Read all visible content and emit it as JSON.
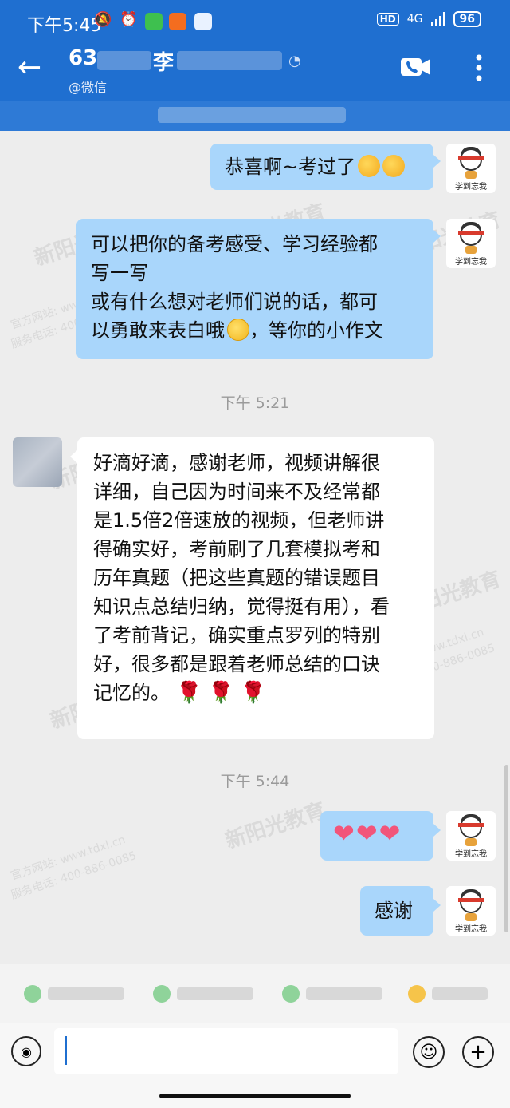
{
  "status_bar": {
    "time": "下午5:45",
    "network": "4G",
    "battery": "96",
    "hd_label": "HD",
    "icons": [
      "mute-bell-icon",
      "alarm-icon",
      "wechat-icon",
      "mi-app-icon",
      "app-icon"
    ]
  },
  "header": {
    "contact_prefix": "63",
    "contact_surname": "李",
    "source": "@微信",
    "back_icon": "back-arrow-icon",
    "call_icon": "video-call-icon",
    "more_icon": "more-vertical-icon"
  },
  "messages": [
    {
      "sender": "me",
      "avatar_text": "学到忘我",
      "text": "恭喜啊~考过了",
      "emoji": [
        "hugging-face",
        "hugging-face"
      ]
    },
    {
      "sender": "me",
      "avatar_text": "学到忘我",
      "lines": [
        "可以把你的备考感受、学习经验都",
        "写一写",
        "或有什么想对老师们说的话，都可",
        "以勇敢来表白哦"
      ],
      "line4_suffix": "，等你的小作文",
      "emoji": [
        "grinning-face"
      ]
    },
    {
      "type": "time",
      "text": "下午 5:21"
    },
    {
      "sender": "other",
      "lines": [
        "好滴好滴，感谢老师，视频讲解很",
        "详细，自己因为时间来不及经常都",
        "是1.5倍2倍速放的视频，但老师讲",
        "得确实好，考前刷了几套模拟考和",
        "历年真题（把这些真题的错误题目",
        "知识点总结归纳，觉得挺有用），看",
        "了考前背记，确实重点罗列的特别",
        "好，很多都是跟着老师总结的口诀",
        "记忆的。"
      ],
      "emoji": [
        "rose",
        "rose",
        "rose"
      ]
    },
    {
      "type": "time",
      "text": "下午 5:44"
    },
    {
      "sender": "me",
      "avatar_text": "学到忘我",
      "hearts": [
        "❤",
        "❤",
        "❤"
      ]
    },
    {
      "sender": "me",
      "avatar_text": "学到忘我",
      "text": "感谢"
    }
  ],
  "watermark": {
    "logo": "新阳光教育",
    "url": "官方网站: www.tdxl.cn",
    "phone": "服务电话: 400-886-0085"
  },
  "input": {
    "value": "",
    "voice_icon": "voice-icon",
    "emoji_icon": "emoji-icon",
    "plus_icon": "plus-icon"
  },
  "colors": {
    "header_bg": "#1f6fd0",
    "my_bubble": "#a9d6fb",
    "their_bubble": "#ffffff",
    "chat_bg": "#ededed"
  }
}
